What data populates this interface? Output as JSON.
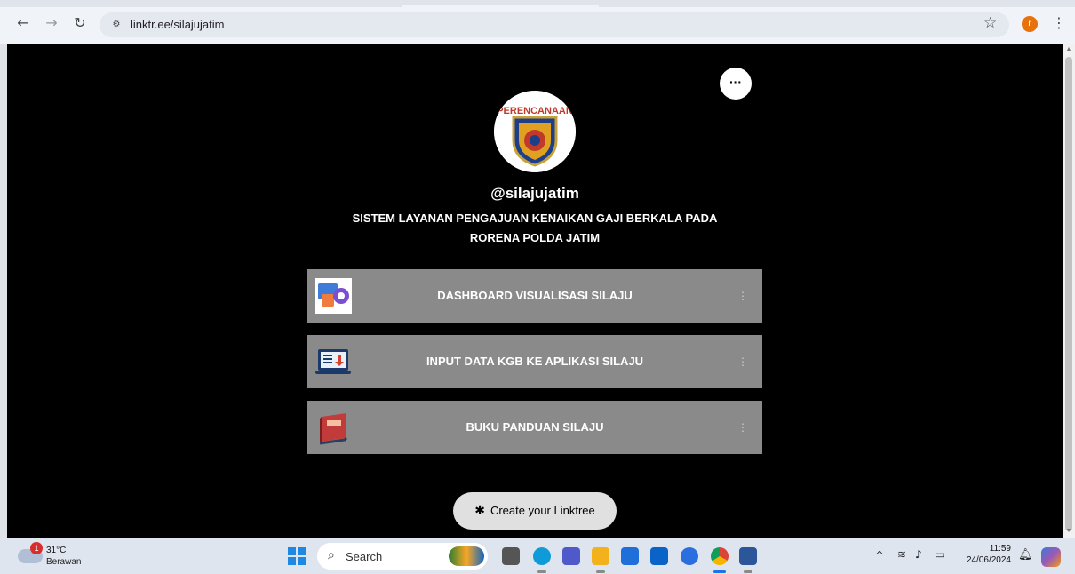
{
  "browser": {
    "url": "linktr.ee/silajujatim",
    "back_icon": "arrow-left-icon",
    "forward_icon": "arrow-right-icon",
    "reload_icon": "reload-icon",
    "profile_initial": "r",
    "accent_color": "#e8710a"
  },
  "profile": {
    "username": "@silajujatim",
    "bio": "SISTEM LAYANAN PENGAJUAN KENAIKAN GAJI BERKALA PADA RORENA POLDA JATIM",
    "logo_text": "PERENCANAAN"
  },
  "links": [
    {
      "label": "DASHBOARD VISUALISASI SILAJU",
      "thumb_icon": "dashboard-gear-icon"
    },
    {
      "label": "INPUT DATA KGB KE APLIKASI SILAJU",
      "thumb_icon": "laptop-document-icon"
    },
    {
      "label": "BUKU PANDUAN SILAJU",
      "thumb_icon": "book-icon"
    }
  ],
  "footer": {
    "create_label": "Create your Linktree"
  },
  "taskbar": {
    "weather_temp": "31°C",
    "weather_desc": "Berawan",
    "weather_badge": "1",
    "search_label": "Search",
    "time": "11:59",
    "date": "24/06/2024"
  }
}
